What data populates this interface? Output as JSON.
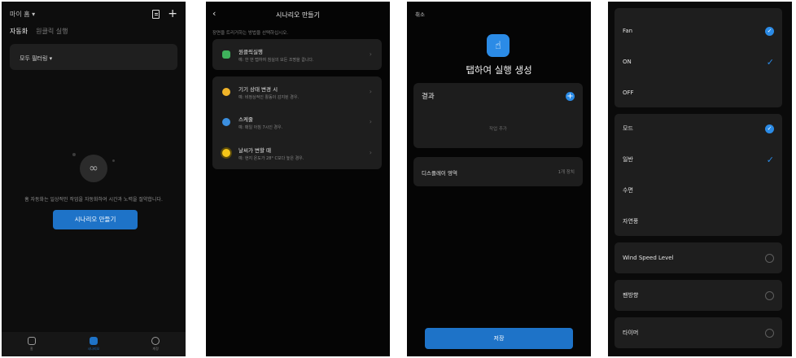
{
  "screen1": {
    "home_label": "마이 홈 ▾",
    "tabs": [
      "자동화",
      "원클릭 실행"
    ],
    "filter_label": "모두 필터링 ▾",
    "empty_text": "홈 자동화는 일상적인 작업을 자동화하여 시간과 노력을 절약합니다.",
    "create_button": "시나리오 만들기",
    "nav": [
      "홈",
      "시나리오",
      "계정"
    ]
  },
  "screen2": {
    "title": "시나리오 만들기",
    "hint": "장면을 트리거하는 방법을 선택하십시오.",
    "items": [
      {
        "title": "원클릭실행",
        "subtitle": "예: 한 번 탭하여 침실의 모든 조명을 끕니다."
      },
      {
        "title": "기기 상태 변경 시",
        "subtitle": "예: 비정상적인 활동이 감지된 경우."
      },
      {
        "title": "스케줄",
        "subtitle": "예: 매일 아침 7시인 경우."
      },
      {
        "title": "날씨가 변할 때",
        "subtitle": "예: 현지 온도가 28° C보다 높은 경우."
      }
    ],
    "colors": {
      "hand": "#3fb25c",
      "bulb": "#f0b429",
      "clock": "#3b8fe0",
      "sun": "#f5c518"
    }
  },
  "screen3": {
    "cancel": "취소",
    "title": "탭하여 실행 생성",
    "result_label": "결과",
    "add_task": "작업 추가",
    "display_label": "디스플레이 영역",
    "display_value": "1개 장치",
    "save_button": "저장"
  },
  "screen4": {
    "group1": [
      "Fan",
      "ON",
      "OFF"
    ],
    "group2": [
      "모드",
      "일반",
      "수면",
      "자연풍"
    ],
    "singles": [
      "Wind Speed Level",
      "팬방향",
      "타이머"
    ]
  },
  "colors": {
    "accent": "#1e73c8",
    "card": "#1e1e1e"
  }
}
